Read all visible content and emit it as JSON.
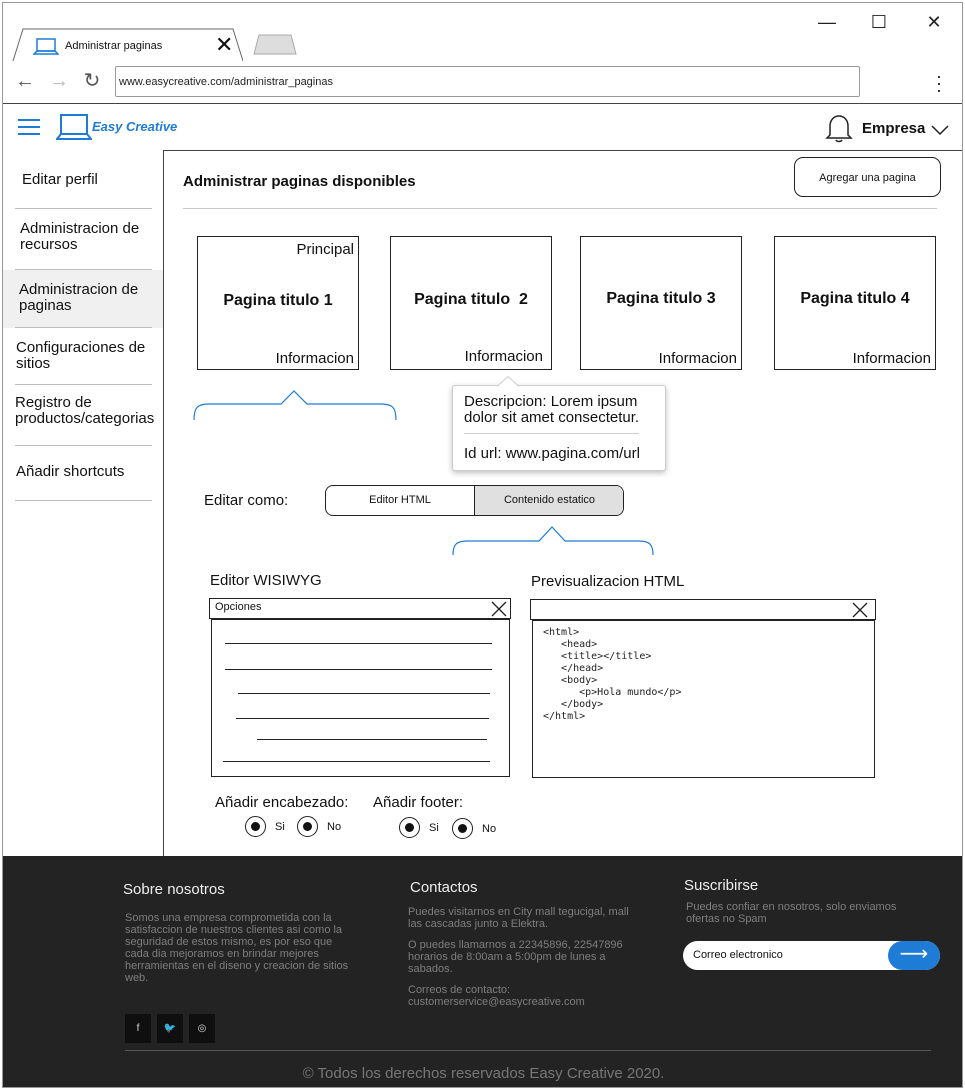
{
  "browser": {
    "tab_title": "Administrar paginas",
    "url": "www.easycreative.com/administrar_paginas"
  },
  "header": {
    "brand": "Easy Creative",
    "company": "Empresa"
  },
  "sidebar": {
    "items": [
      {
        "label": "Editar perfil"
      },
      {
        "label": "Administracion de recursos"
      },
      {
        "label": "Administracion de paginas"
      },
      {
        "label": "Configuraciones de sitios"
      },
      {
        "label": "Registro de productos/categorias"
      },
      {
        "label": "Añadir shortcuts"
      }
    ]
  },
  "main": {
    "title": "Administrar paginas disponibles",
    "add_button": "Agregar una pagina",
    "cards": [
      {
        "title": "Pagina titulo 1",
        "info": "Informacion",
        "badge": "Principal"
      },
      {
        "title": "Pagina titulo  2",
        "info": "Informacion"
      },
      {
        "title": "Pagina titulo 3",
        "info": "Informacion"
      },
      {
        "title": "Pagina titulo 4",
        "info": "Informacion"
      }
    ],
    "tooltip": {
      "description": "Descripcion: Lorem ipsum dolor sit amet consectetur.",
      "url": "Id url: www.pagina.com/url"
    },
    "edit_as": {
      "label": "Editar como:",
      "options": [
        "Editor HTML",
        "Contenido estatico"
      ],
      "selected": "Contenido estatico"
    },
    "wysiwyg": {
      "label": "Editor WISIWYG",
      "toolbar": "Opciones"
    },
    "preview": {
      "label": "Previsualizacion HTML",
      "code": "<html>\n   <head>\n   <title></title>\n   </head>\n   <body>\n      <p>Hola mundo</p>\n   </body>\n</html>"
    },
    "header_opt": {
      "label": "Añadir encabezado:",
      "yes": "Si",
      "no": "No"
    },
    "footer_opt": {
      "label": "Añadir footer:",
      "yes": "Si",
      "no": "No"
    }
  },
  "footer": {
    "about_title": "Sobre nosotros",
    "about_text": "Somos una empresa comprometida con la satisfaccion de nuestros clientes asi como la seguridad de estos mismo, es por eso que cada dia mejoramos en brindar mejores herramientas en el diseno y creacion de sitios web.",
    "contact_title": "Contactos",
    "contact_visit": "Puedes visitarnos en City mall tegucigal, mall las cascadas junto a Elektra.",
    "contact_phone": "O puedes llamarnos a 22345896, 22547896 horarios de 8:00am a 5:00pm de lunes a sabados.",
    "contact_mail": "Correos de contacto: customerservice@easycreative.com",
    "subscribe_title": "Suscribirse",
    "subscribe_text": "Puedes confiar en nosotros, solo enviamos ofertas no Spam",
    "subscribe_placeholder": "Correo electronico",
    "copyright": "© Todos los derechos reservados Easy Creative 2020."
  }
}
